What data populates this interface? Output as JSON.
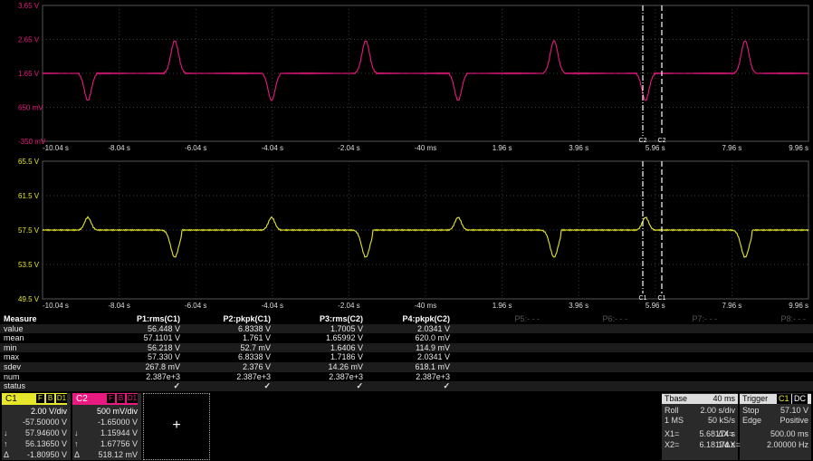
{
  "channel_top": {
    "color": "#e8197f",
    "y_labels": [
      "3.65 V",
      "2.65 V",
      "1.65 V",
      "650 mV",
      "-350 mV"
    ],
    "x_labels": [
      "-10.04 s",
      "-8.04 s",
      "-6.04 s",
      "-4.04 s",
      "-2.04 s",
      "-40 ms",
      "1.96 s",
      "3.96 s",
      "5.96 s",
      "7.96 s",
      "9.96 s"
    ],
    "cursor_labels": [
      "C2",
      "C2"
    ],
    "ref_marker": "C2"
  },
  "channel_bottom": {
    "color": "#e6e62a",
    "y_labels": [
      "65.5 V",
      "61.5 V",
      "57.5 V",
      "53.5 V",
      "49.5 V"
    ],
    "x_labels": [
      "-10.04 s",
      "-8.04 s",
      "-6.04 s",
      "-4.04 s",
      "-2.04 s",
      "-40 ms",
      "1.96 s",
      "3.96 s",
      "5.96 s",
      "7.96 s",
      "9.96 s"
    ],
    "cursor_labels": [
      "C1",
      "C1"
    ]
  },
  "measure": {
    "header": [
      "Measure",
      "P1:rms(C1)",
      "P2:pkpk(C1)",
      "P3:rms(C2)",
      "P4:pkpk(C2)",
      "P5:- - -",
      "P6:- - -",
      "P7:- - -",
      "P8:- - -"
    ],
    "rows": [
      {
        "label": "value",
        "vals": [
          "56.448 V",
          "6.8338 V",
          "1.7005 V",
          "2.0341 V"
        ]
      },
      {
        "label": "mean",
        "vals": [
          "57.1101 V",
          "1.761 V",
          "1.65992 V",
          "620.0 mV"
        ]
      },
      {
        "label": "min",
        "vals": [
          "56.218 V",
          "52.7 mV",
          "1.6406 V",
          "114.9 mV"
        ]
      },
      {
        "label": "max",
        "vals": [
          "57.330 V",
          "6.8338 V",
          "1.7186 V",
          "2.0341 V"
        ]
      },
      {
        "label": "sdev",
        "vals": [
          "267.8 mV",
          "2.376 V",
          "14.26 mV",
          "618.1 mV"
        ]
      },
      {
        "label": "num",
        "vals": [
          "2.387e+3",
          "2.387e+3",
          "2.387e+3",
          "2.387e+3"
        ]
      },
      {
        "label": "status",
        "vals": [
          "✓",
          "✓",
          "✓",
          "✓"
        ]
      }
    ]
  },
  "c1_desc": {
    "name": "C1",
    "color": "#e6e62a",
    "flags": [
      "F",
      "B",
      "D1"
    ],
    "lines": [
      {
        "k": "",
        "v": "2.00 V/div"
      },
      {
        "k": "",
        "v": "-57.50000 V"
      },
      {
        "k": "↓",
        "v": "57.94600 V"
      },
      {
        "k": "↑",
        "v": "56.13650 V"
      },
      {
        "k": "Δ",
        "v": "-1.80950 V"
      }
    ]
  },
  "c2_desc": {
    "name": "C2",
    "color": "#e8197f",
    "flags": [
      "F",
      "B",
      "D1"
    ],
    "lines": [
      {
        "k": "",
        "v": "500 mV/div"
      },
      {
        "k": "",
        "v": "-1.65000 V"
      },
      {
        "k": "↓",
        "v": "1.15944 V"
      },
      {
        "k": "↑",
        "v": "1.67756 V"
      },
      {
        "k": "Δ",
        "v": "518.12 mV"
      }
    ]
  },
  "zoom_symbol": "+",
  "timebase": {
    "title": "Tbase",
    "value": "40 ms",
    "roll": "Roll",
    "div": "2.00 s/div",
    "mem": "1 MS",
    "rate": "50 kS/s"
  },
  "trigger": {
    "title": "Trigger",
    "tag1": "C1",
    "tag2": "DC",
    "mode": "Stop",
    "level": "57.10 V",
    "type": "Edge",
    "slope": "Positive"
  },
  "cursors": {
    "x1_label": "X1=",
    "x1": "5.68174 s",
    "dx_label": "ΔX=",
    "dx": "500.00 ms",
    "x2_label": "X2=",
    "x2": "6.18174 s",
    "inv_label": "1/ΔX=",
    "inv": "2.00000 Hz"
  }
}
